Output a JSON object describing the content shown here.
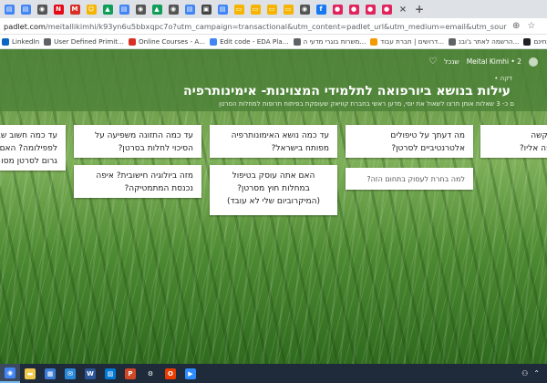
{
  "browser": {
    "tabs": [
      {
        "icon": "docs-icon",
        "color": "#4285f4",
        "glyph": "▤"
      },
      {
        "icon": "docs-icon",
        "color": "#4285f4",
        "glyph": "▤"
      },
      {
        "icon": "chrome-icon",
        "color": "#555555",
        "glyph": "◉"
      },
      {
        "icon": "netflix-icon",
        "color": "#e50914",
        "glyph": "N"
      },
      {
        "icon": "gmail-icon",
        "color": "#d93025",
        "glyph": "M"
      },
      {
        "icon": "emoji-icon",
        "color": "#f4b400",
        "glyph": "☺"
      },
      {
        "icon": "drive-icon",
        "color": "#0f9d58",
        "glyph": "▲"
      },
      {
        "icon": "docs-icon",
        "color": "#4285f4",
        "glyph": "▤"
      },
      {
        "icon": "chrome-icon",
        "color": "#555555",
        "glyph": "◉"
      },
      {
        "icon": "drive-icon",
        "color": "#0f9d58",
        "glyph": "▲"
      },
      {
        "icon": "chrome-icon",
        "color": "#555555",
        "glyph": "◉"
      },
      {
        "icon": "docs-icon",
        "color": "#4285f4",
        "glyph": "▤"
      },
      {
        "icon": "image-icon",
        "color": "#444444",
        "glyph": "▣"
      },
      {
        "icon": "docs-icon",
        "color": "#4285f4",
        "glyph": "▤"
      },
      {
        "icon": "slides-icon",
        "color": "#f4b400",
        "glyph": "▭"
      },
      {
        "icon": "slides-icon",
        "color": "#f4b400",
        "glyph": "▭"
      },
      {
        "icon": "slides-icon",
        "color": "#f4b400",
        "glyph": "▭"
      },
      {
        "icon": "slides-icon",
        "color": "#f4b400",
        "glyph": "▭"
      },
      {
        "icon": "chrome-icon",
        "color": "#555555",
        "glyph": "◉"
      },
      {
        "icon": "facebook-icon",
        "color": "#1877f2",
        "glyph": "f"
      },
      {
        "icon": "padlet-icon",
        "color": "#e0245e",
        "glyph": "●"
      },
      {
        "icon": "padlet-icon",
        "color": "#e0245e",
        "glyph": "●"
      },
      {
        "icon": "padlet-icon",
        "color": "#e0245e",
        "glyph": "●"
      },
      {
        "icon": "padlet-icon",
        "color": "#e0245e",
        "glyph": "●"
      }
    ],
    "close_glyph": "×",
    "new_tab_glyph": "+",
    "url_host": "padlet.com",
    "url_rest": "/meitallikimhi/k93yn6u5bbxqpc7o?utm_campaign=transactional&utm_content=padlet_url&utm_medium=email&utm_source=started_a_padlet",
    "bookmarks": [
      {
        "label": "LinkedIn",
        "color": "#0a66c2"
      },
      {
        "label": "User Defined Primit...",
        "color": "#5f6368"
      },
      {
        "label": "Online Courses - A...",
        "color": "#d93025"
      },
      {
        "label": "Edit code - EDA Pla...",
        "color": "#4285f4"
      },
      {
        "label": "משרות בוגרי מדעי ה...",
        "color": "#5f6368"
      },
      {
        "label": "דרושים | חברת עבוד...",
        "color": "#f29900"
      },
      {
        "label": "הרשמה לאתר ג'ובנ...",
        "color": "#5f6368"
      },
      {
        "label": "קורס תכנות בחינם ...",
        "color": "#202124"
      }
    ]
  },
  "padlet": {
    "author_line": "Meital Kimhi • 2",
    "share_label": "שנכל",
    "author_meta": "דקה •",
    "title": "עילות בנושא ביורפואה לתלמידי המצוינות- אימינותרפיה",
    "subtitle": "ם כ- 3 שאלות אותן תרצו לשאול את יוסי, מדען ראשי בחברת קוויאק שעוסקת בפיתוח תרופות למחלות הסרטן",
    "cards": [
      {
        "text": "מה דעתך על טיפולים\nאלטרנטיביים לסרטן?",
        "muted": false
      },
      {
        "text": "למה בחרת לעסוק בתחום הזה?",
        "muted": true
      },
      {
        "text": "עד כמה נושא האימונותרפיה\nמפותח בישראל?",
        "muted": false
      },
      {
        "text": "האם אתה עוסק בטיפול\nבמחלות חוץ מסרטן?\n(המיקרוביום שלי לא עובד)",
        "muted": false
      },
      {
        "text": "עד כמה התזונה משפיעה על\nהסיכוי לחלות בסרטן?",
        "muted": false
      },
      {
        "text": "מזה ביולוגיה חישובית? איפה\nנכנסת המתמטיקה?",
        "muted": false
      },
      {
        "text": "עד כמה חשוב שב\nלפפילומה? האם ב\nגרום לסרטן מסו",
        "muted": false
      },
      {
        "text": "כמה קל הוא הקשה\nמחקר על תרופה אליו?",
        "muted": false
      }
    ]
  },
  "taskbar": {
    "items": [
      {
        "icon": "chrome-icon",
        "glyph": "◉",
        "color": "#4285f4"
      },
      {
        "icon": "file-explorer-icon",
        "glyph": "▬",
        "color": "#f2c94c"
      },
      {
        "icon": "store-icon",
        "glyph": "▦",
        "color": "#3a7bd5"
      },
      {
        "icon": "mail-icon",
        "glyph": "✉",
        "color": "#2a88d8"
      },
      {
        "icon": "word-icon",
        "glyph": "W",
        "color": "#2b579a"
      },
      {
        "icon": "photos-icon",
        "glyph": "▨",
        "color": "#0078d4"
      },
      {
        "icon": "powerpoint-icon",
        "glyph": "P",
        "color": "#d24726"
      },
      {
        "icon": "settings-icon",
        "glyph": "⚙",
        "color": "#1f2a3a"
      },
      {
        "icon": "office-icon",
        "glyph": "O",
        "color": "#eb3c00"
      },
      {
        "icon": "zoom-icon",
        "glyph": "▶",
        "color": "#2d8cff"
      }
    ]
  }
}
